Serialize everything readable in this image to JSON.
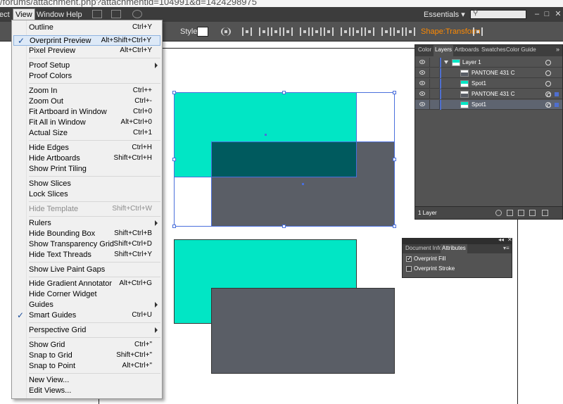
{
  "browser": {
    "url": "/forums/attachment.php?attachmentid=104991&d=1424298975"
  },
  "menubar": {
    "items": [
      "ect",
      "View",
      "Window",
      "Help"
    ],
    "workspace": "Essentials",
    "workspace_arrow": "▾",
    "window_controls": [
      "–",
      "□",
      "✕"
    ]
  },
  "control_bar": {
    "style_label": "Style:",
    "shape_link": "Shape:",
    "transform_link": "Transform"
  },
  "view_menu": {
    "items": [
      {
        "label": "Outline",
        "shortcut": "Ctrl+Y"
      },
      {
        "label": "Overprint Preview",
        "shortcut": "Alt+Shift+Ctrl+Y",
        "checked": true,
        "highlighted": true,
        "check": "✓"
      },
      {
        "label": "Pixel Preview",
        "shortcut": "Alt+Ctrl+Y"
      },
      {
        "label": "Proof Setup",
        "shortcut": ""
      },
      {
        "label": "Proof Colors",
        "shortcut": ""
      },
      {
        "label": "Zoom In",
        "shortcut": "Ctrl++"
      },
      {
        "label": "Zoom Out",
        "shortcut": "Ctrl+-"
      },
      {
        "label": "Fit Artboard in Window",
        "shortcut": "Ctrl+0"
      },
      {
        "label": "Fit All in Window",
        "shortcut": "Alt+Ctrl+0"
      },
      {
        "label": "Actual Size",
        "shortcut": "Ctrl+1"
      },
      {
        "label": "Hide Edges",
        "shortcut": "Ctrl+H"
      },
      {
        "label": "Hide Artboards",
        "shortcut": "Shift+Ctrl+H"
      },
      {
        "label": "Show Print Tiling",
        "shortcut": ""
      },
      {
        "label": "Show Slices",
        "shortcut": ""
      },
      {
        "label": "Lock Slices",
        "shortcut": ""
      },
      {
        "label": "Hide Template",
        "shortcut": "Shift+Ctrl+W",
        "disabled": true
      },
      {
        "label": "Rulers",
        "shortcut": ""
      },
      {
        "label": "Hide Bounding Box",
        "shortcut": "Shift+Ctrl+B"
      },
      {
        "label": "Show Transparency Grid",
        "shortcut": "Shift+Ctrl+D"
      },
      {
        "label": "Hide Text Threads",
        "shortcut": "Shift+Ctrl+Y"
      },
      {
        "label": "Show Live Paint Gaps",
        "shortcut": ""
      },
      {
        "label": "Hide Gradient Annotator",
        "shortcut": "Alt+Ctrl+G"
      },
      {
        "label": "Hide Corner Widget",
        "shortcut": ""
      },
      {
        "label": "Guides",
        "shortcut": ""
      },
      {
        "label": "Smart Guides",
        "shortcut": "Ctrl+U",
        "checked": true,
        "check": "✓"
      },
      {
        "label": "Perspective Grid",
        "shortcut": ""
      },
      {
        "label": "Show Grid",
        "shortcut": "Ctrl+\""
      },
      {
        "label": "Snap to Grid",
        "shortcut": "Shift+Ctrl+\""
      },
      {
        "label": "Snap to Point",
        "shortcut": "Alt+Ctrl+\""
      },
      {
        "label": "New View...",
        "shortcut": ""
      },
      {
        "label": "Edit Views...",
        "shortcut": ""
      }
    ]
  },
  "layers_panel": {
    "tabs": [
      "Color",
      "Layers",
      "Artboards",
      "Swatches",
      "Color Guide"
    ],
    "active_tab": "Layers",
    "menu_icon": "»",
    "layer_name": "Layer 1",
    "rows": [
      "PANTONE 431 C",
      "Spot1",
      "PANTONE 431 C",
      "Spot1"
    ],
    "count": "1 Layer"
  },
  "attributes_panel": {
    "collapse": "◂◂",
    "close": "✕",
    "tabs": [
      "Document Info",
      "Attributes"
    ],
    "active_tab": "Attributes",
    "menu_icon": "▾≡",
    "overprint_fill": {
      "label": "Overprint Fill",
      "checked": true,
      "mark": "✓"
    },
    "overprint_stroke": {
      "label": "Overprint Stroke",
      "checked": false
    }
  },
  "colors": {
    "teal": "#01e6c5",
    "slate": "#5a5e66",
    "overprint_dark": "#005a5e",
    "selection_blue": "#4a6fdc",
    "orange_link": "#ff8a00"
  }
}
